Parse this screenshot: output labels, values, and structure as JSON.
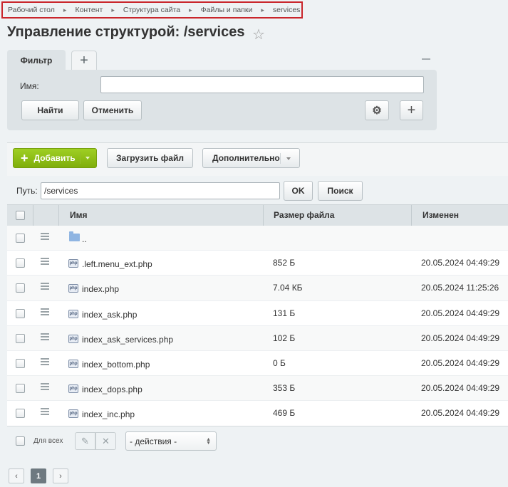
{
  "breadcrumb": [
    "Рабочий стол",
    "Контент",
    "Структура сайта",
    "Файлы и папки",
    "services"
  ],
  "page_title": "Управление структурой: /services",
  "filter": {
    "tab_label": "Фильтр",
    "add_tab_label": "+",
    "name_label": "Имя:",
    "name_value": "",
    "find_button": "Найти",
    "cancel_button": "Отменить",
    "add_button": "+"
  },
  "toolbar": {
    "add_label": "Добавить",
    "upload_label": "Загрузить файл",
    "more_label": "Дополнительно"
  },
  "path": {
    "label": "Путь:",
    "value": "/services",
    "ok_label": "OK",
    "search_label": "Поиск"
  },
  "table": {
    "columns": [
      "Имя",
      "Размер файла",
      "Изменен"
    ],
    "rows": [
      {
        "type": "folder-up",
        "name": "..",
        "size": "",
        "modified": ""
      },
      {
        "type": "php",
        "name": ".left.menu_ext.php",
        "size": "852 Б",
        "modified": "20.05.2024 04:49:29"
      },
      {
        "type": "php",
        "name": "index.php",
        "size": "7.04 КБ",
        "modified": "20.05.2024 11:25:26"
      },
      {
        "type": "php",
        "name": "index_ask.php",
        "size": "131 Б",
        "modified": "20.05.2024 04:49:29"
      },
      {
        "type": "php",
        "name": "index_ask_services.php",
        "size": "102 Б",
        "modified": "20.05.2024 04:49:29"
      },
      {
        "type": "php",
        "name": "index_bottom.php",
        "size": "0 Б",
        "modified": "20.05.2024 04:49:29"
      },
      {
        "type": "php",
        "name": "index_dops.php",
        "size": "353 Б",
        "modified": "20.05.2024 04:49:29"
      },
      {
        "type": "php",
        "name": "index_inc.php",
        "size": "469 Б",
        "modified": "20.05.2024 04:49:29"
      }
    ]
  },
  "footer": {
    "for_all_label": "Для всех",
    "actions_placeholder": "- действия -"
  },
  "pagination": {
    "current_page": "1",
    "prev": "‹",
    "next": "›"
  }
}
